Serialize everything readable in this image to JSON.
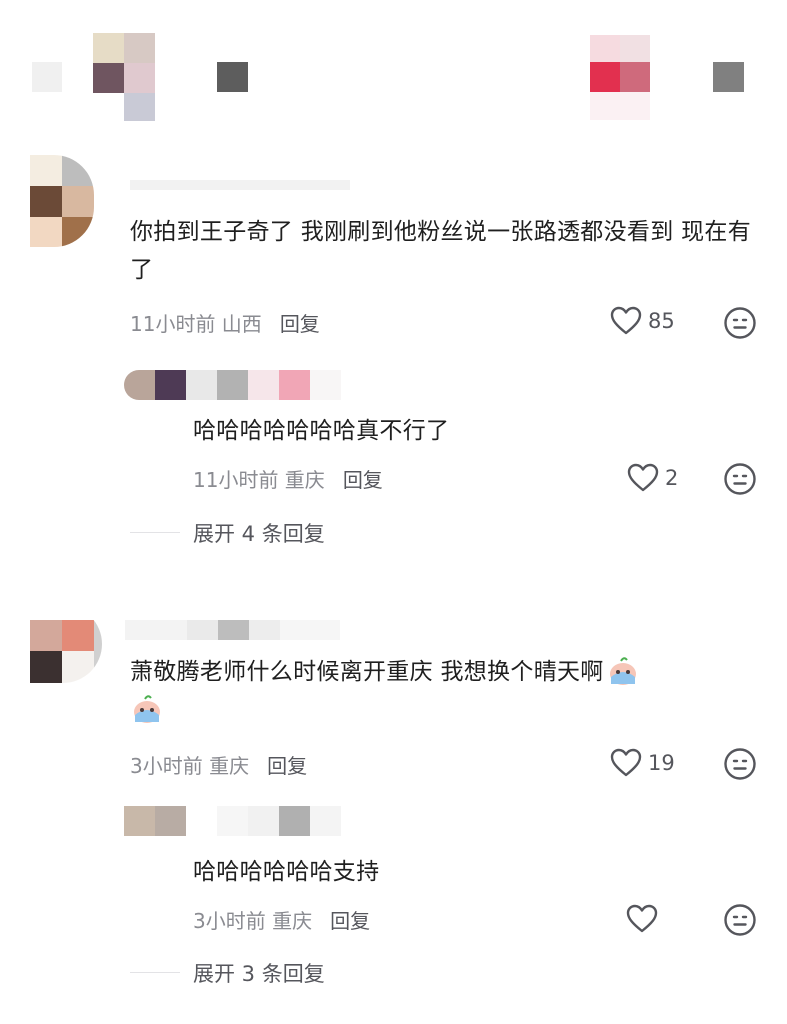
{
  "colors": {
    "accent": "#fe2c55",
    "text": "#1f1f1f",
    "meta": "#8a8b91"
  },
  "comments": [
    {
      "text": "你拍到王子奇了  我刚刷到他粉丝说一张路透都没看到  现在有了",
      "time_location": "11小时前 山西",
      "reply_label": "回复",
      "likes": "85",
      "heart_icon": "heart-icon",
      "dislike_icon": "dislike-icon",
      "replies": [
        {
          "text": "哈哈哈哈哈哈哈真不行了",
          "time_location": "11小时前 重庆",
          "reply_label": "回复",
          "likes": "2"
        }
      ],
      "expand_label": "展开 4 条回复"
    },
    {
      "text": "萧敬腾老师什么时候离开重庆 我想换个晴天啊",
      "time_location": "3小时前 重庆",
      "reply_label": "回复",
      "likes": "19",
      "emoji": "crying-emoji",
      "replies": [
        {
          "text": "哈哈哈哈哈哈支持",
          "time_location": "3小时前 重庆",
          "reply_label": "回复",
          "likes": ""
        }
      ],
      "expand_label": "展开 3 条回复"
    }
  ]
}
